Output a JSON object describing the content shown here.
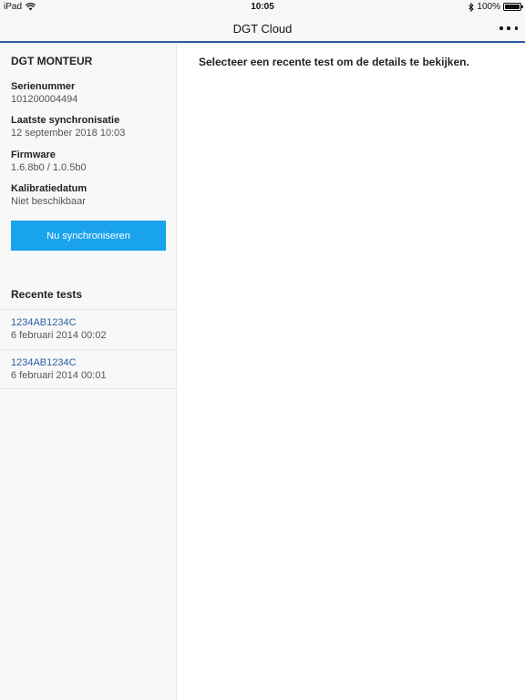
{
  "status_bar": {
    "carrier": "iPad",
    "time": "10:05",
    "battery_percent": "100%",
    "battery_level": 1.0,
    "icons": [
      "wifi-icon",
      "bluetooth-icon",
      "battery-icon"
    ]
  },
  "nav": {
    "title": "DGT Cloud",
    "menu_icon": "more-horizontal-icon"
  },
  "device": {
    "name": "DGT MONTEUR",
    "fields": [
      {
        "label": "Serienummer",
        "value": "101200004494"
      },
      {
        "label": "Laatste synchronisatie",
        "value": "12 september 2018 10:03"
      },
      {
        "label": "Firmware",
        "value": "1.6.8b0 / 1.0.5b0"
      },
      {
        "label": "Kalibratiedatum",
        "value": "Niet beschikbaar"
      }
    ],
    "sync_button": "Nu synchroniseren"
  },
  "recent": {
    "title": "Recente tests",
    "items": [
      {
        "id": "1234AB1234C",
        "date": "6 februari 2014 00:02"
      },
      {
        "id": "1234AB1234C",
        "date": "6 februari 2014 00:01"
      }
    ]
  },
  "main": {
    "message": "Selecteer een recente test om de details te bekijken."
  },
  "colors": {
    "accent": "#19a3ec",
    "link": "#2e5ea6",
    "nav_border": "#2c5aa0"
  }
}
